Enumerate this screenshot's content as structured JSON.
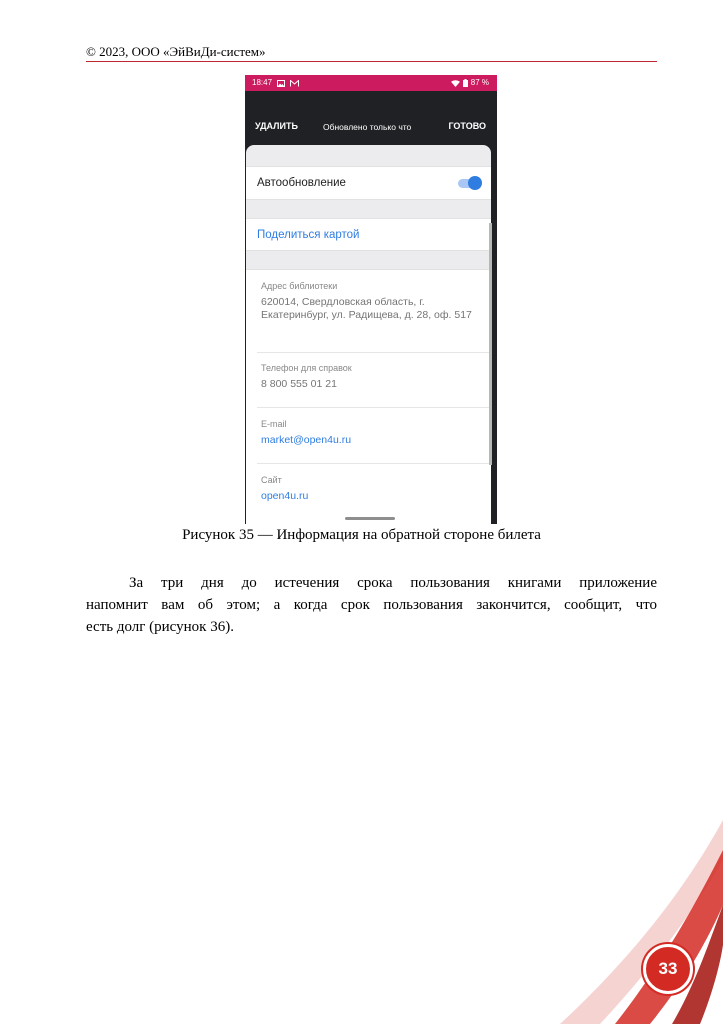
{
  "header": {
    "copyright": "© 2023, ООО «ЭйВиДи-систем»"
  },
  "phone": {
    "status": {
      "time": "18:47",
      "battery": "87 %"
    },
    "toolbar": {
      "delete_label": "УДАЛИТЬ",
      "updated_label": "Обновлено только что",
      "done_label": "ГОТОВО"
    },
    "auto_update": {
      "label": "Автообновление",
      "enabled": true
    },
    "share": {
      "label": "Поделиться картой"
    },
    "fields": [
      {
        "label": "Адрес библиотеки",
        "value": "620014, Свердловская область, г. Екатеринбург, ул. Радищева, д. 28, оф. 517"
      },
      {
        "label": "Телефон для справок",
        "value": "8 800 555 01 21"
      },
      {
        "label": "E-mail",
        "value": "market@open4u.ru"
      },
      {
        "label": "Сайт",
        "value": "open4u.ru"
      }
    ],
    "colors": {
      "status_bar": "#cc1b5f",
      "accent": "#2f7de1",
      "toolbar": "#202124"
    }
  },
  "caption": "Рисунок 35 — Информация на обратной стороне билета",
  "paragraph": {
    "line1": "За три дня до истечения срока пользования книгами приложение",
    "line2": "напомнит вам об этом; а когда срок пользования закончится, сообщит, что",
    "line3": "есть долг (рисунок 36)."
  },
  "page_number": "33"
}
